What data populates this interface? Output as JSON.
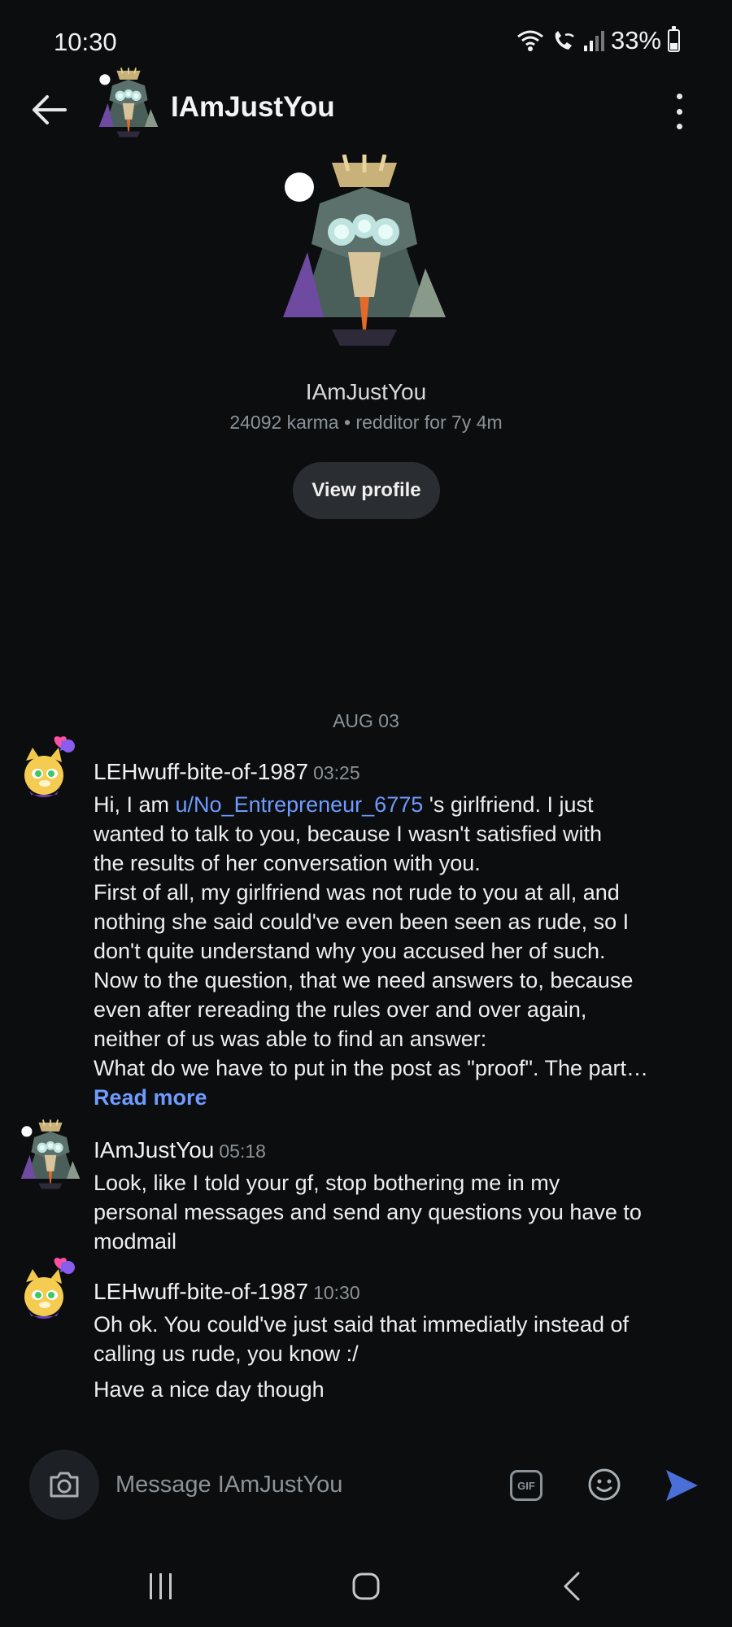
{
  "status_bar": {
    "time": "10:30",
    "battery": "33%",
    "battery_level_percent": 33
  },
  "header": {
    "title": "IAmJustYou",
    "back_icon": "arrow-left-icon",
    "menu_icon": "more-vertical-icon"
  },
  "profile": {
    "name": "IAmJustYou",
    "meta": "24092 karma • redditor for 7y 4m",
    "view_profile_label": "View profile"
  },
  "date_separator": "AUG 03",
  "messages": [
    {
      "author": "LEHwuff-bite-of-1987",
      "time": "03:25",
      "line1_pre": "Hi, I am ",
      "mention": "u/No_Entrepreneur_6775",
      "line1_post": " 's girlfriend. I just",
      "lines": [
        "wanted to talk to you, because I wasn't satisfied with",
        "the results of her conversation with you.",
        "First of all, my girlfriend was not rude to you at all, and",
        "nothing she said could've even been seen as rude, so I",
        "don't quite understand why you accused her of such.",
        "Now to the question, that we need answers to, because",
        "even after rereading the rules over and over again,",
        "neither of us was able to find an answer:",
        "What do we have to put in the post as \"proof\". The part…"
      ],
      "read_more": "Read more"
    },
    {
      "author": "IAmJustYou",
      "time": "05:18",
      "lines": [
        "Look, like I told your gf, stop bothering me in my",
        "personal messages and send any questions you have to",
        "modmail"
      ]
    },
    {
      "author": "LEHwuff-bite-of-1987",
      "time": "10:30",
      "lines": [
        "Oh ok. You could've just said that immediatly instead of",
        "calling us rude, you know :/"
      ],
      "extra_line": "Have a nice day though"
    }
  ],
  "composer": {
    "placeholder": "Message IAmJustYou",
    "gif_label": "GIF",
    "camera_icon": "camera-icon",
    "emoji_icon": "smiley-icon",
    "send_icon": "send-icon"
  },
  "colors": {
    "background": "#0b0d0f",
    "link": "#6f9bff",
    "send": "#4a6fd6"
  }
}
